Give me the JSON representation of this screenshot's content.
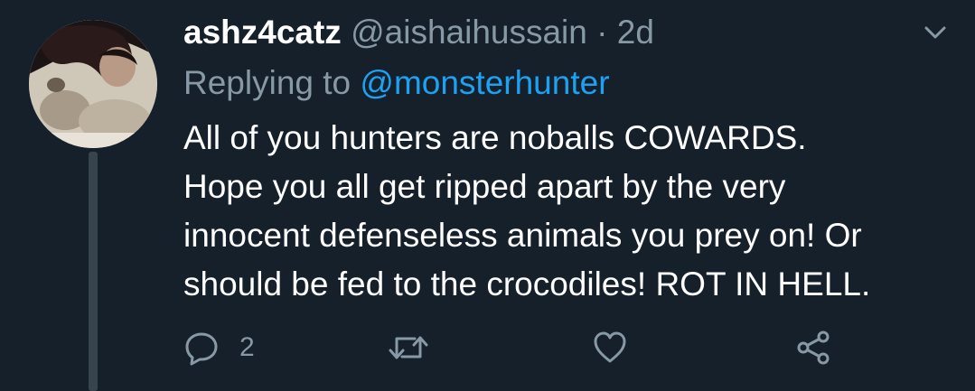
{
  "tweet": {
    "display_name": "ashz4catz",
    "handle": "@aishaihussain",
    "separator": "·",
    "time": "2d",
    "reply_prefix": "Replying to",
    "reply_to": "@monsterhunter",
    "body_lines": [
      "All of you hunters are noballs COWARDS.",
      "Hope you all get ripped apart by the very",
      "innocent defenseless animals you prey on! Or",
      "should be fed to the crocodiles! ROT IN HELL."
    ],
    "reply_count": "2"
  },
  "icons": {
    "menu": "chevron-down-icon",
    "reply": "reply-icon",
    "retweet": "retweet-icon",
    "like": "heart-icon",
    "share": "share-icon"
  },
  "colors": {
    "background": "#15202b",
    "text": "#ffffff",
    "secondary": "#8899a6",
    "link": "#1da1f2",
    "thread_line": "#38444d"
  }
}
